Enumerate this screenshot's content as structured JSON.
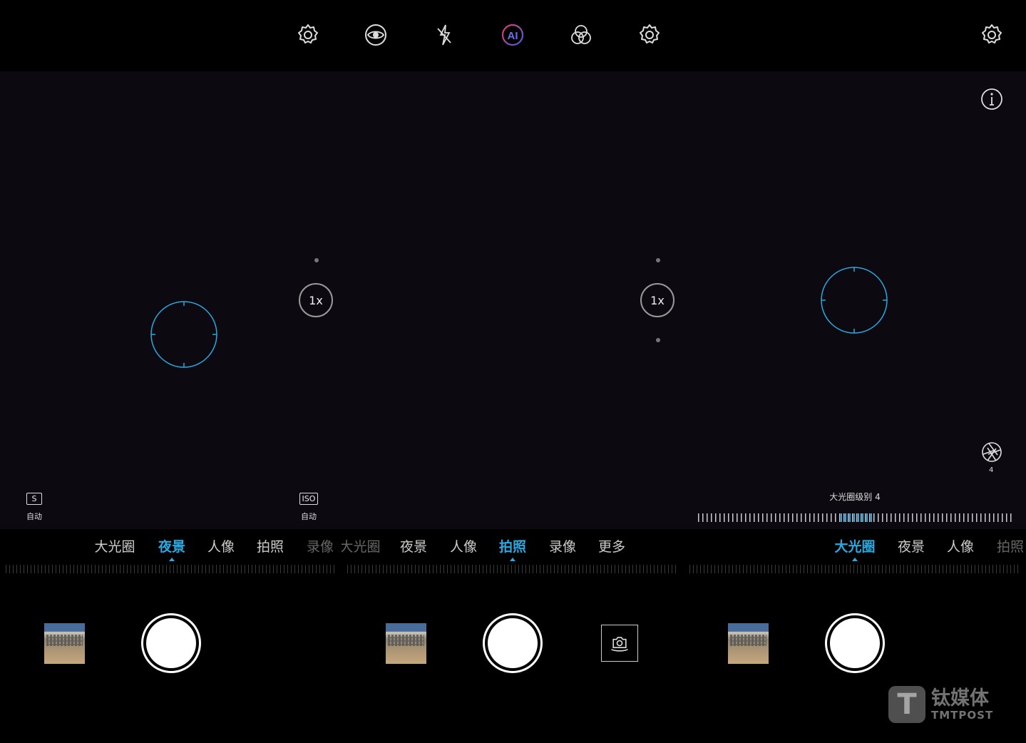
{
  "colors": {
    "accent": "#2aa9e0",
    "viewfinder": "#0c0910",
    "background": "#000000"
  },
  "panel1": {
    "top_icons": [
      "settings-icon"
    ],
    "zoom_label": "1x",
    "shutter_param": {
      "box": "S",
      "label": "自动"
    },
    "iso_param": {
      "box": "ISO",
      "label": "自动"
    },
    "modes": [
      "大光圈",
      "夜景",
      "人像",
      "拍照",
      "录像"
    ],
    "active_mode": "夜景"
  },
  "panel2": {
    "top_icons": [
      "settings-icon",
      "aperture-eye-icon",
      "flash-off-icon",
      "ai-icon",
      "filter-icon",
      "settings-icon"
    ],
    "ai_label": "AI",
    "zoom_label": "1x",
    "modes": [
      "大光圈",
      "夜景",
      "人像",
      "拍照",
      "录像",
      "更多"
    ],
    "active_mode": "拍照"
  },
  "panel3": {
    "aperture_value": "4",
    "aperture_level_label": "大光圈级别 4",
    "modes": [
      "大光圈",
      "夜景",
      "人像",
      "拍照"
    ],
    "active_mode": "大光圈"
  },
  "watermark": {
    "cn": "钛媒体",
    "en": "TMTPOST",
    "logo": "T"
  }
}
